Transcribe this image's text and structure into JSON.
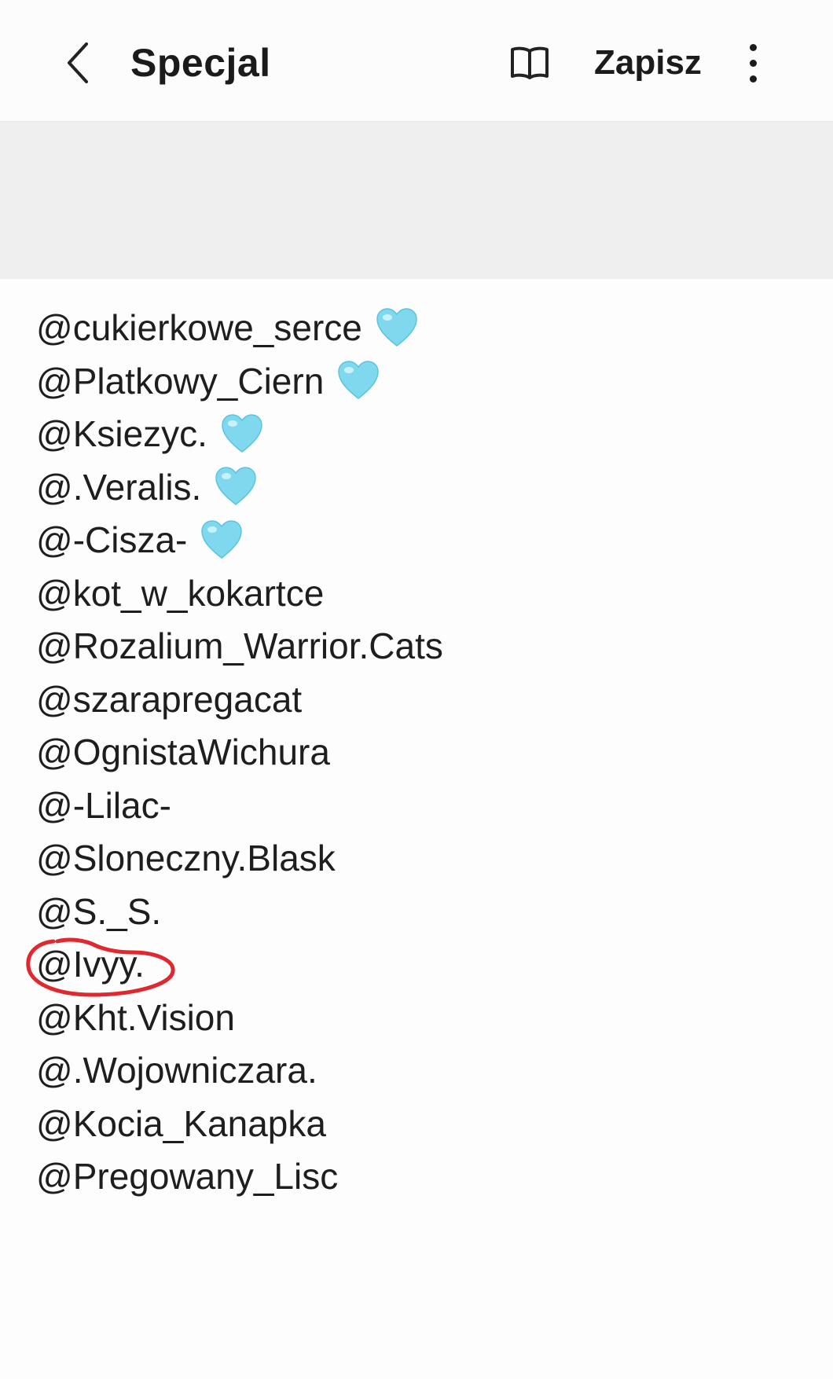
{
  "header": {
    "title": "Specjal",
    "save_label": "Zapisz",
    "back_icon": "chevron-left-icon",
    "reader_icon": "book-open-icon",
    "more_icon": "more-vertical-icon"
  },
  "mentions": [
    {
      "text": "@cukierkowe_serce",
      "heart": true
    },
    {
      "text": "@Platkowy_Ciern",
      "heart": true
    },
    {
      "text": "@Ksiezyc.",
      "heart": true
    },
    {
      "text": "@.Veralis.",
      "heart": true
    },
    {
      "text": "@-Cisza-",
      "heart": true
    },
    {
      "text": "@kot_w_kokartce",
      "heart": false
    },
    {
      "text": "@Rozalium_Warrior.Cats",
      "heart": false
    },
    {
      "text": "@szarapregacat",
      "heart": false
    },
    {
      "text": "@OgnistaWichura",
      "heart": false
    },
    {
      "text": "@-Lilac-",
      "heart": false
    },
    {
      "text": "@Sloneczny.Blask",
      "heart": false
    },
    {
      "text": "@S._S.",
      "heart": false
    },
    {
      "text": "@Ivyy.",
      "heart": false,
      "circled": true
    },
    {
      "text": "@Kht.Vision",
      "heart": false
    },
    {
      "text": "@.Wojowniczara.",
      "heart": false
    },
    {
      "text": "@Kocia_Kanapka",
      "heart": false
    },
    {
      "text": "@Pregowany_Lisc",
      "heart": false
    }
  ],
  "colors": {
    "heart": "#7fd8ee",
    "circle_mark": "#e0282f",
    "banner": "#efefef"
  }
}
